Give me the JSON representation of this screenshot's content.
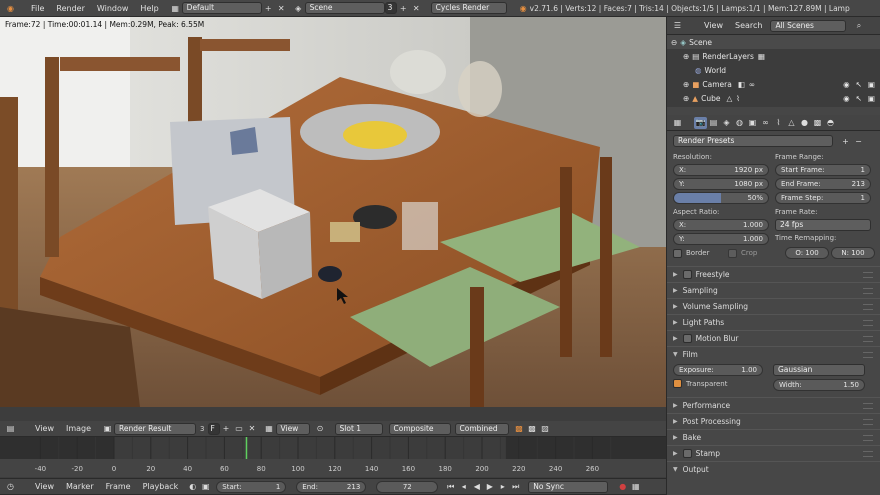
{
  "topbar": {
    "menus": [
      "File",
      "Render",
      "Window",
      "Help"
    ],
    "screen_layout": "Default",
    "scene": "Scene",
    "scene_users": "3",
    "engine": "Cycles Render",
    "stats": "v2.71.6 | Verts:12 | Faces:7 | Tris:14 | Objects:1/5 | Lamps:1/1 | Mem:127.89M | Lamp"
  },
  "viewport": {
    "status": "Frame:72 | Time:00:01.14 | Mem:0.29M, Peak: 6.55M"
  },
  "outliner": {
    "view": "View",
    "search": "Search",
    "filter": "All Scenes",
    "items": [
      "Scene",
      "RenderLayers",
      "World",
      "Camera",
      "Cube"
    ]
  },
  "properties": {
    "presets": "Render Presets",
    "resolution_label": "Resolution:",
    "res_x_label": "X:",
    "res_x": "1920 px",
    "res_y_label": "Y:",
    "res_y": "1080 px",
    "res_pct": "50%",
    "frame_range_label": "Frame Range:",
    "start_label": "Start Frame:",
    "start": "1",
    "end_label": "End Frame:",
    "end": "213",
    "step_label": "Frame Step:",
    "step": "1",
    "aspect_label": "Aspect Ratio:",
    "asp_x_label": "X:",
    "asp_x": "1.000",
    "asp_y_label": "Y:",
    "asp_y": "1.000",
    "framerate_label": "Frame Rate:",
    "framerate": "24 fps",
    "remap_label": "Time Remapping:",
    "remap_o": "O: 100",
    "remap_n": "N: 100",
    "border": "Border",
    "crop": "Crop",
    "panels_a": [
      "Freestyle",
      "Sampling",
      "Volume Sampling",
      "Light Paths",
      "Motion Blur"
    ],
    "film": "Film",
    "exposure_label": "Exposure:",
    "exposure": "1.00",
    "filter": "Gaussian",
    "transparent": "Transparent",
    "width_label": "Width:",
    "width": "1.50",
    "panels_b": [
      "Performance",
      "Post Processing",
      "Bake",
      "Stamp",
      "Output"
    ]
  },
  "image_editor_header": {
    "view": "View",
    "image": "Image",
    "image_name": "Render Result",
    "users": "3",
    "fake": "F",
    "view2": "View",
    "slot": "Slot 1",
    "pass": "Composite",
    "mode": "Combined"
  },
  "timeline": {
    "ticks": [
      "-40",
      "-20",
      "0",
      "20",
      "40",
      "60",
      "80",
      "100",
      "120",
      "140",
      "160",
      "180",
      "200",
      "220",
      "240",
      "260"
    ],
    "current_frame": 72,
    "range_start": 0,
    "range_end": 213
  },
  "timeline_header": {
    "view": "View",
    "marker": "Marker",
    "frame": "Frame",
    "playback": "Playback",
    "start_label": "Start:",
    "start": "1",
    "end_label": "End:",
    "end": "213",
    "current": "72",
    "sync": "No Sync"
  }
}
